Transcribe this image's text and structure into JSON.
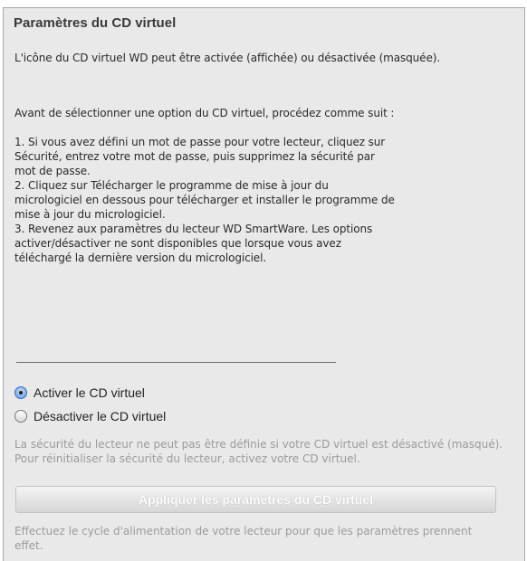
{
  "panel": {
    "title": "Paramètres du CD virtuel",
    "intro": "L'icône du CD virtuel WD peut être activée (affichée) ou désactivée (masquée).",
    "steps_heading": "Avant de sélectionner une option du CD virtuel, procédez comme suit :",
    "steps": [
      "1. Si vous avez défini un mot de passe pour votre lecteur, cliquez sur\nSécurité, entrez votre mot de passe, puis supprimez la sécurité par\nmot de passe.",
      "2. Cliquez sur Télécharger le programme de mise à jour du\nmicrologiciel en dessous pour télécharger et installer le programme de\nmise à jour du micrologiciel.",
      "3. Revenez aux paramètres du lecteur WD SmartWare. Les options\nactiver/désactiver ne sont disponibles que lorsque vous avez\ntéléchargé la dernière version du micrologiciel."
    ],
    "options": [
      {
        "label": "Activer le CD virtuel",
        "selected": true
      },
      {
        "label": "Désactiver le CD virtuel",
        "selected": false
      }
    ],
    "security_note": "La sécurité du lecteur ne peut pas être définie si votre CD virtuel est désactivé (masqué). Pour réinitialiser la sécurité du lecteur, activez votre CD virtuel.",
    "apply_button": {
      "label": "Appliquer les paramètres du CD virtuel",
      "enabled": false
    },
    "power_cycle_note": "Effectuez le cycle d'alimentation de votre lecteur pour que les paramètres prennent effet."
  }
}
